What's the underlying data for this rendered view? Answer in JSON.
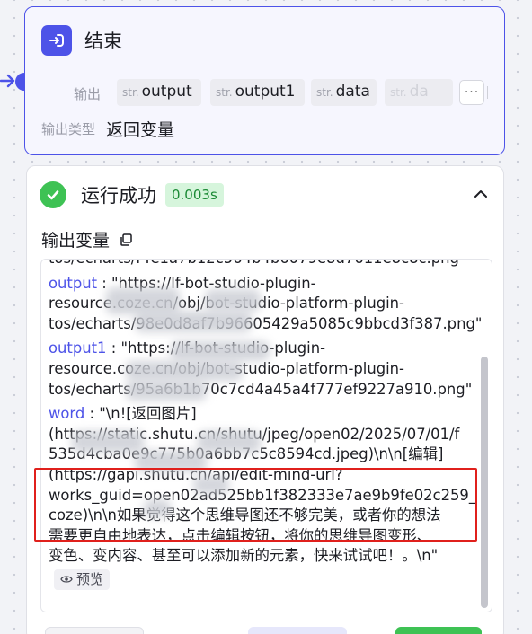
{
  "end_node": {
    "title": "结束",
    "icon": "exit-icon",
    "output_label": "输出",
    "outputs": [
      {
        "type": "str.",
        "name": "output"
      },
      {
        "type": "str.",
        "name": "output1"
      },
      {
        "type": "str.",
        "name": "data"
      },
      {
        "type": "str.",
        "name": "da"
      }
    ],
    "more": "···",
    "output_type_label": "输出类型",
    "output_type_value": "返回变量",
    "accent": "#4d53e8"
  },
  "result": {
    "status": "运行成功",
    "time": "0.003s",
    "output_vars_label": "输出变量",
    "status_color": "#3ec254",
    "preview_label": "预览",
    "entries": {
      "top_cut": "tos/echarts/f4e1a7b12c564b4b6079e8d7611e8c8c.png\"",
      "output_key": "output",
      "output_lines": [
        " : \"https://lf-bot-studio-plugin-",
        "resource.coze.cn/obj/bot-studio-platform-plugin-",
        "tos/echarts/98e0d8af7b96605429a5085c9bbcd3f387.png\""
      ],
      "output1_key": "output1",
      "output1_lines": [
        " : \"https://lf-bot-studio-plugin-",
        "resource.coze.cn/obj/bot-studio-platform-plugin-",
        "tos/echarts/95a6b1b70c7cd4a45a4f777ef9227a910.png\""
      ],
      "word_key": "word",
      "word_lines": [
        " : \"\\n![返回图片]",
        "(https://static.shutu.cn/shutu/jpeg/open02/2025/07/01/f",
        "535d4cba0e9c775b0a6bb7c5c8594cd.jpeg)\\n\\n[编辑]",
        "(https://gapi.shutu.cn/api/edit-mind-url?",
        "works_guid=open02ad525bb1f382333e7ae9b9fe02c259_",
        "coze)\\n\\n如果觉得这个思维导图还不够完美，或者你的想法",
        "需要更自由地表达，点击编辑按钮，将你的思维导图变形、",
        "变色、变内容、甚至可以添加新的元素，快来试试吧！。\\n\""
      ]
    }
  }
}
